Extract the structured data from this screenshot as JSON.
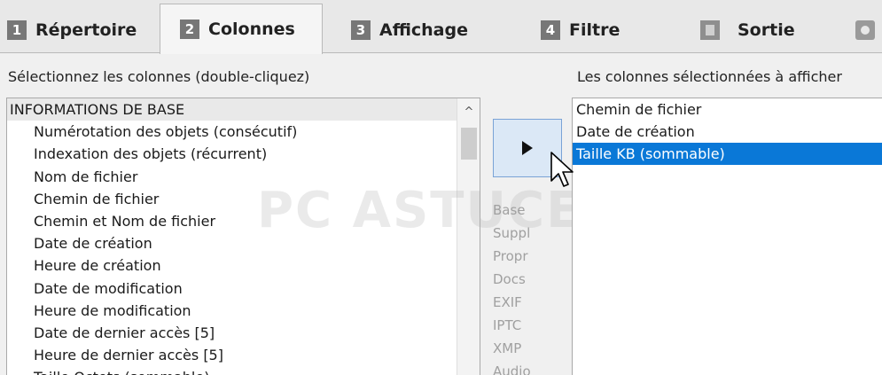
{
  "tabs": [
    {
      "num": "1",
      "label": "Répertoire"
    },
    {
      "num": "2",
      "label": "Colonnes"
    },
    {
      "num": "3",
      "label": "Affichage"
    },
    {
      "num": "4",
      "label": "Filtre"
    },
    {
      "num": "",
      "label": "Sortie"
    }
  ],
  "left_panel": {
    "label": "Sélectionnez les colonnes (double-cliquez)",
    "group": "INFORMATIONS DE BASE",
    "items": [
      "Numérotation des objets (consécutif)",
      "Indexation des objets  (récurrent)",
      "Nom de fichier",
      "Chemin de fichier",
      "Chemin et Nom de fichier",
      "Date de création",
      "Heure de création",
      "Date de modification",
      "Heure de modification",
      "Date de dernier accès [5]",
      "Heure de dernier accès [5]",
      "Taille Octets (sommable)"
    ],
    "scroll_up": "^"
  },
  "middle": {
    "categories": [
      "Base",
      "Suppl",
      "Propr",
      "Docs",
      "EXIF",
      "IPTC",
      "XMP",
      "Audio"
    ]
  },
  "right_panel": {
    "label": "Les colonnes sélectionnées à afficher",
    "items": [
      "Chemin de fichier",
      "Date de création",
      "Taille KB  (sommable)"
    ],
    "selected_index": 2
  },
  "watermark": "PC ASTUCES",
  "colors": {
    "selection": "#0a78d7",
    "button_bg": "#dbe8f6",
    "button_border": "#7aa3d6"
  },
  "icons": {
    "add_button": "play-icon",
    "tab_sortie": "document-icon",
    "tab_options": "gear-icon",
    "pointer": "mouse-cursor-icon"
  }
}
